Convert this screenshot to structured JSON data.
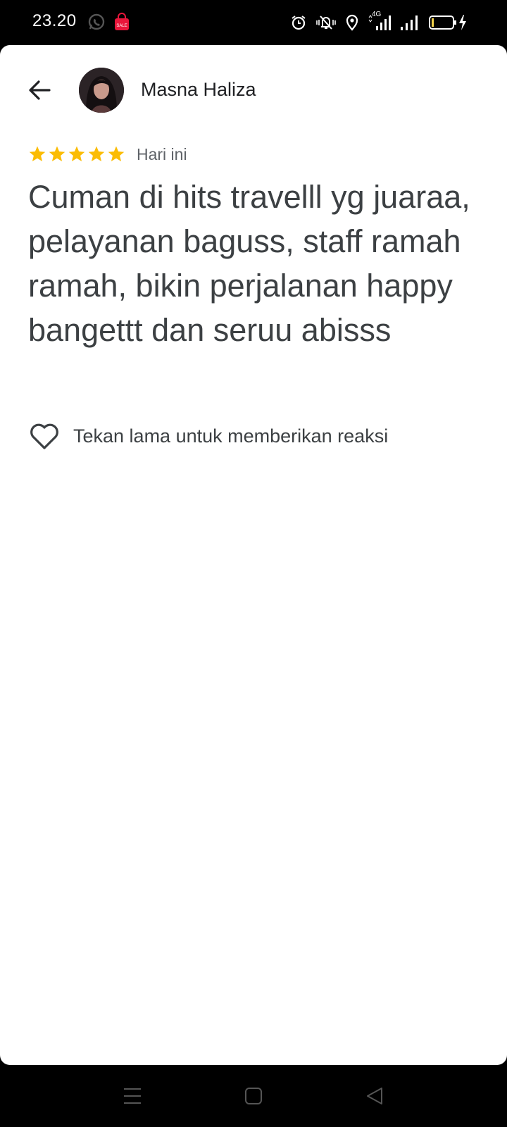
{
  "status_bar": {
    "time": "23.20",
    "network_label": "4G",
    "icons": [
      "whatsapp-icon",
      "shopping-bag-sale-icon",
      "alarm-icon",
      "vibrate-off-icon",
      "location-icon",
      "signal-icon",
      "signal-icon",
      "battery-charging-icon"
    ],
    "shop_badge_text": "SALE"
  },
  "review": {
    "reviewer_name": "Masna Haliza",
    "rating": 5,
    "rating_max": 5,
    "date": "Hari ini",
    "text": "Cuman di hits travelll yg juaraa, pelayanan baguss, staff ramah ramah, bikin perjalanan happy bangettt dan seruu abisss"
  },
  "reaction": {
    "label": "Tekan lama untuk memberikan reaksi",
    "icon": "heart-outline-icon"
  },
  "colors": {
    "star": "#fbbc04",
    "text_primary": "#202124",
    "text_secondary": "#5f6368",
    "shop_red": "#e8163b"
  },
  "nav_bar": {
    "icons": [
      "recent-apps-icon",
      "home-icon",
      "back-triangle-icon"
    ]
  }
}
